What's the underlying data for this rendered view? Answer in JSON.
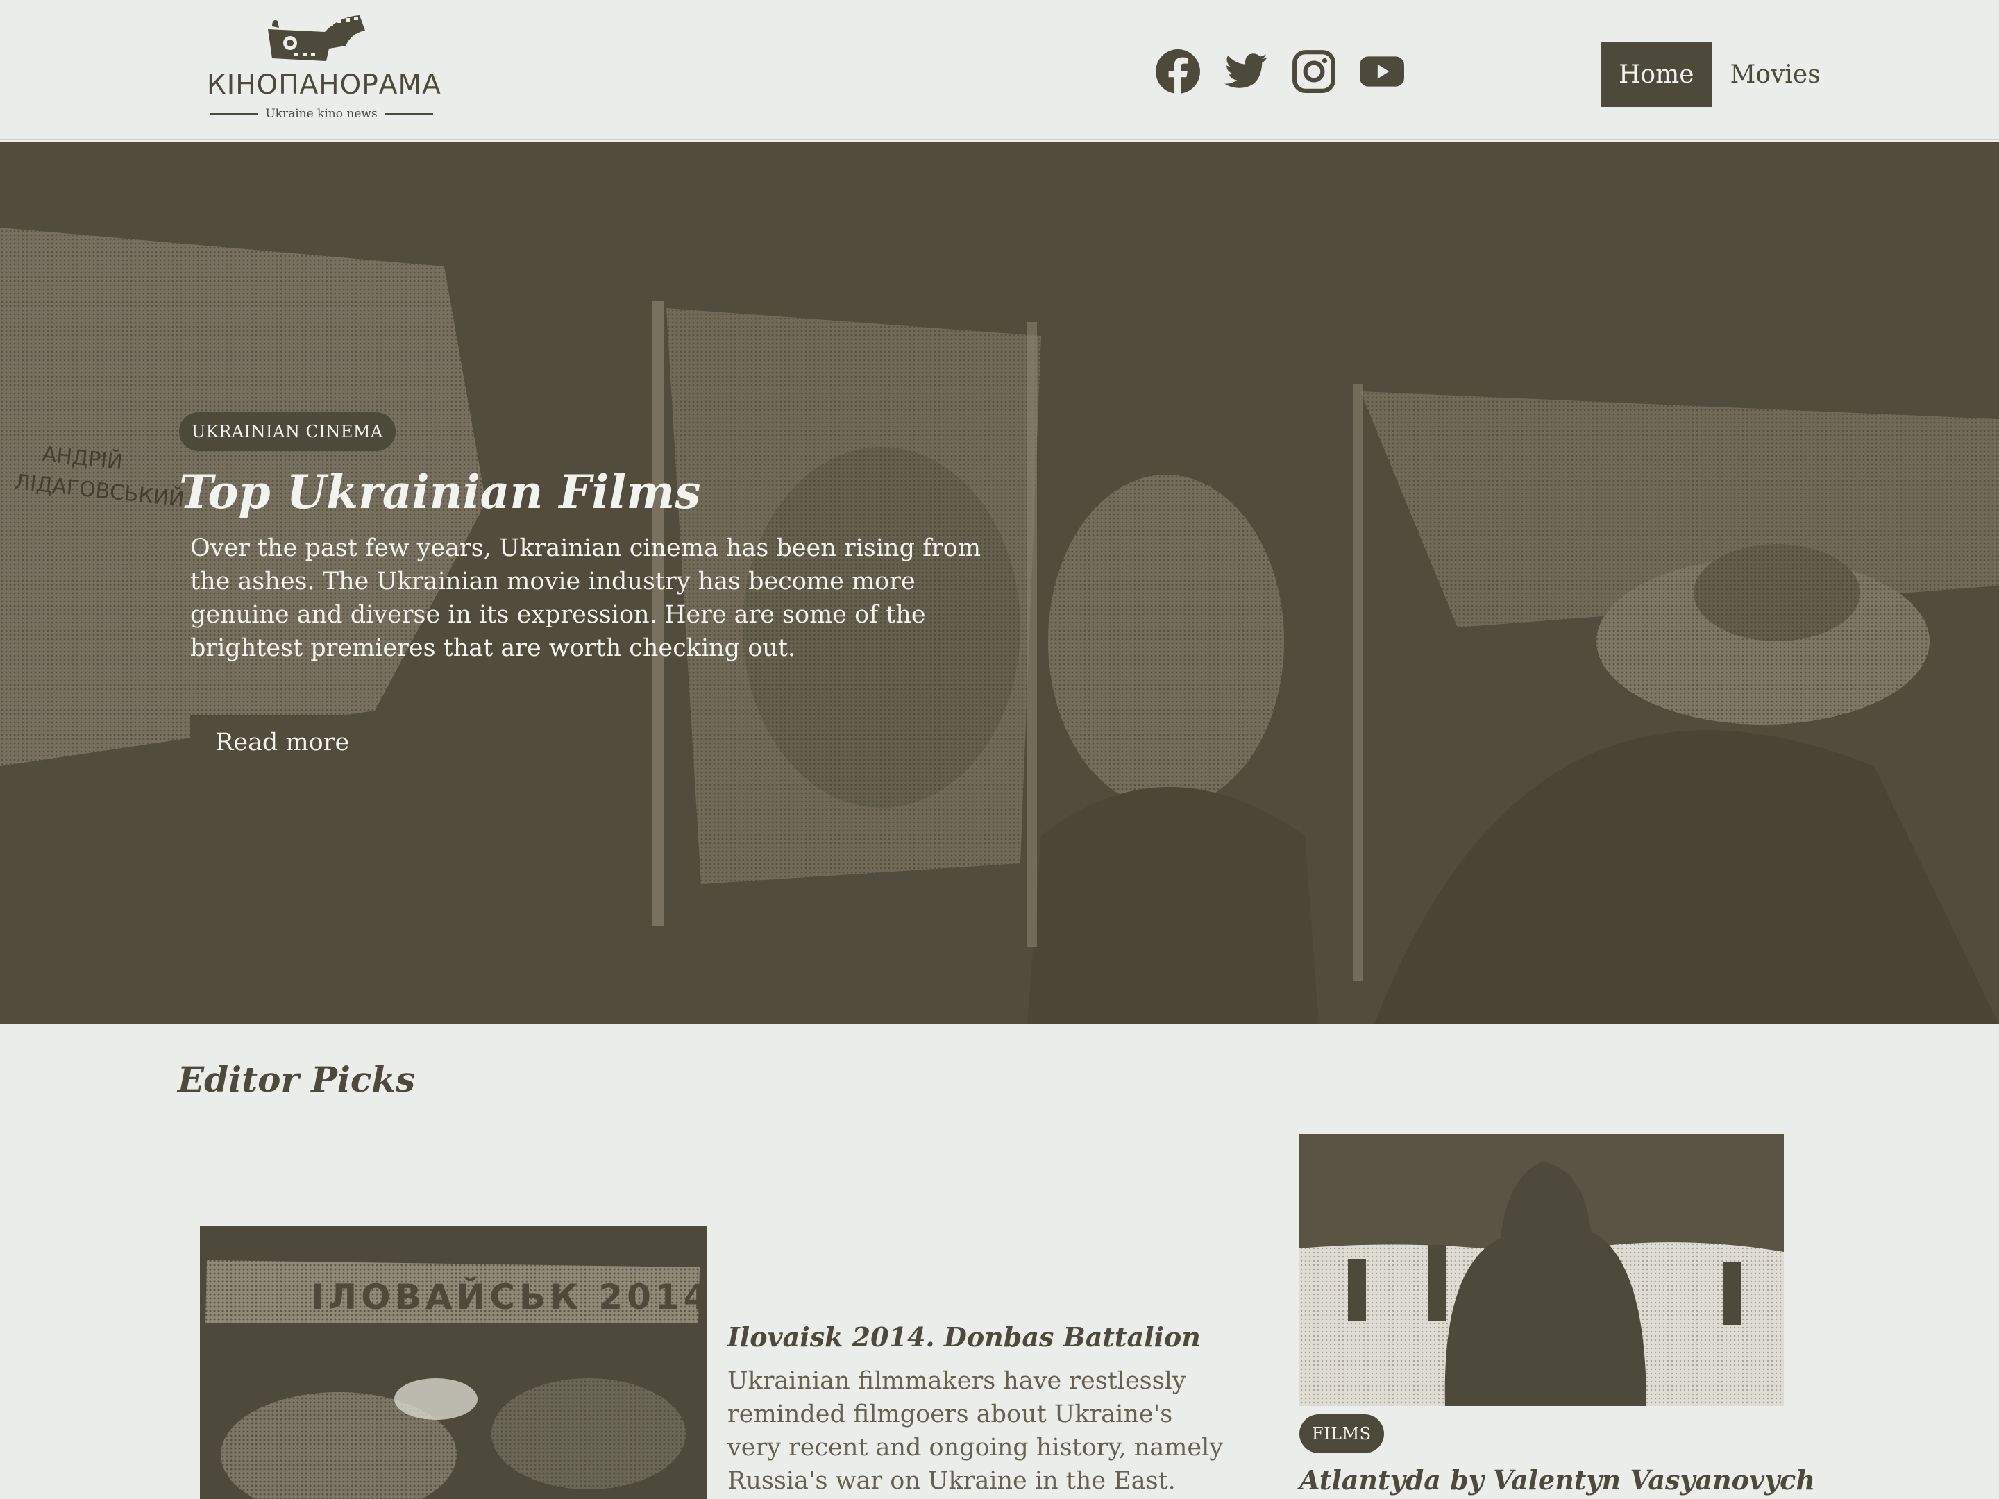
{
  "brand": {
    "name": "КІНОПАНОРАМА",
    "tagline": "Ukraine kino news",
    "color": "#4e4a3b"
  },
  "socials": [
    {
      "icon": "facebook-icon"
    },
    {
      "icon": "twitter-icon"
    },
    {
      "icon": "instagram-icon"
    },
    {
      "icon": "youtube-icon"
    }
  ],
  "nav": {
    "items": [
      {
        "label": "Home",
        "active": true
      },
      {
        "label": "Movies",
        "active": false
      }
    ]
  },
  "hero": {
    "category": "UKRAINIAN CINEMA",
    "title": "Top Ukrainian Films",
    "text": "Over the past few years, Ukrainian cinema has been rising from the ashes. The Ukrainian movie industry has become more genuine and diverse in its expression. Here are some of the brightest premieres that are worth checking out.",
    "button": "Read more",
    "poster_text_1": "АНДРІЙ",
    "poster_text_2": "ЛІДАГОВСЬКИЙ"
  },
  "editor_picks": {
    "title": "Editor Picks",
    "items": [
      {
        "image_caption": "ІЛОВАЙСЬК 2014",
        "title": "Ilovaisk 2014. Donbas Battalion",
        "excerpt": "Ukrainian filmmakers have restlessly reminded filmgoers about Ukraine's very recent and ongoing history, namely Russia's war on Ukraine in the East. Ivan Tymchuk,"
      },
      {
        "category": "FILMS",
        "title": "Atlantyda by Valentyn Vasyanovych"
      }
    ]
  },
  "colors": {
    "background": "#ebedea",
    "accent": "#4e4a3b",
    "hero_bg": "#524c3c",
    "light_text": "#f2f2ee"
  }
}
